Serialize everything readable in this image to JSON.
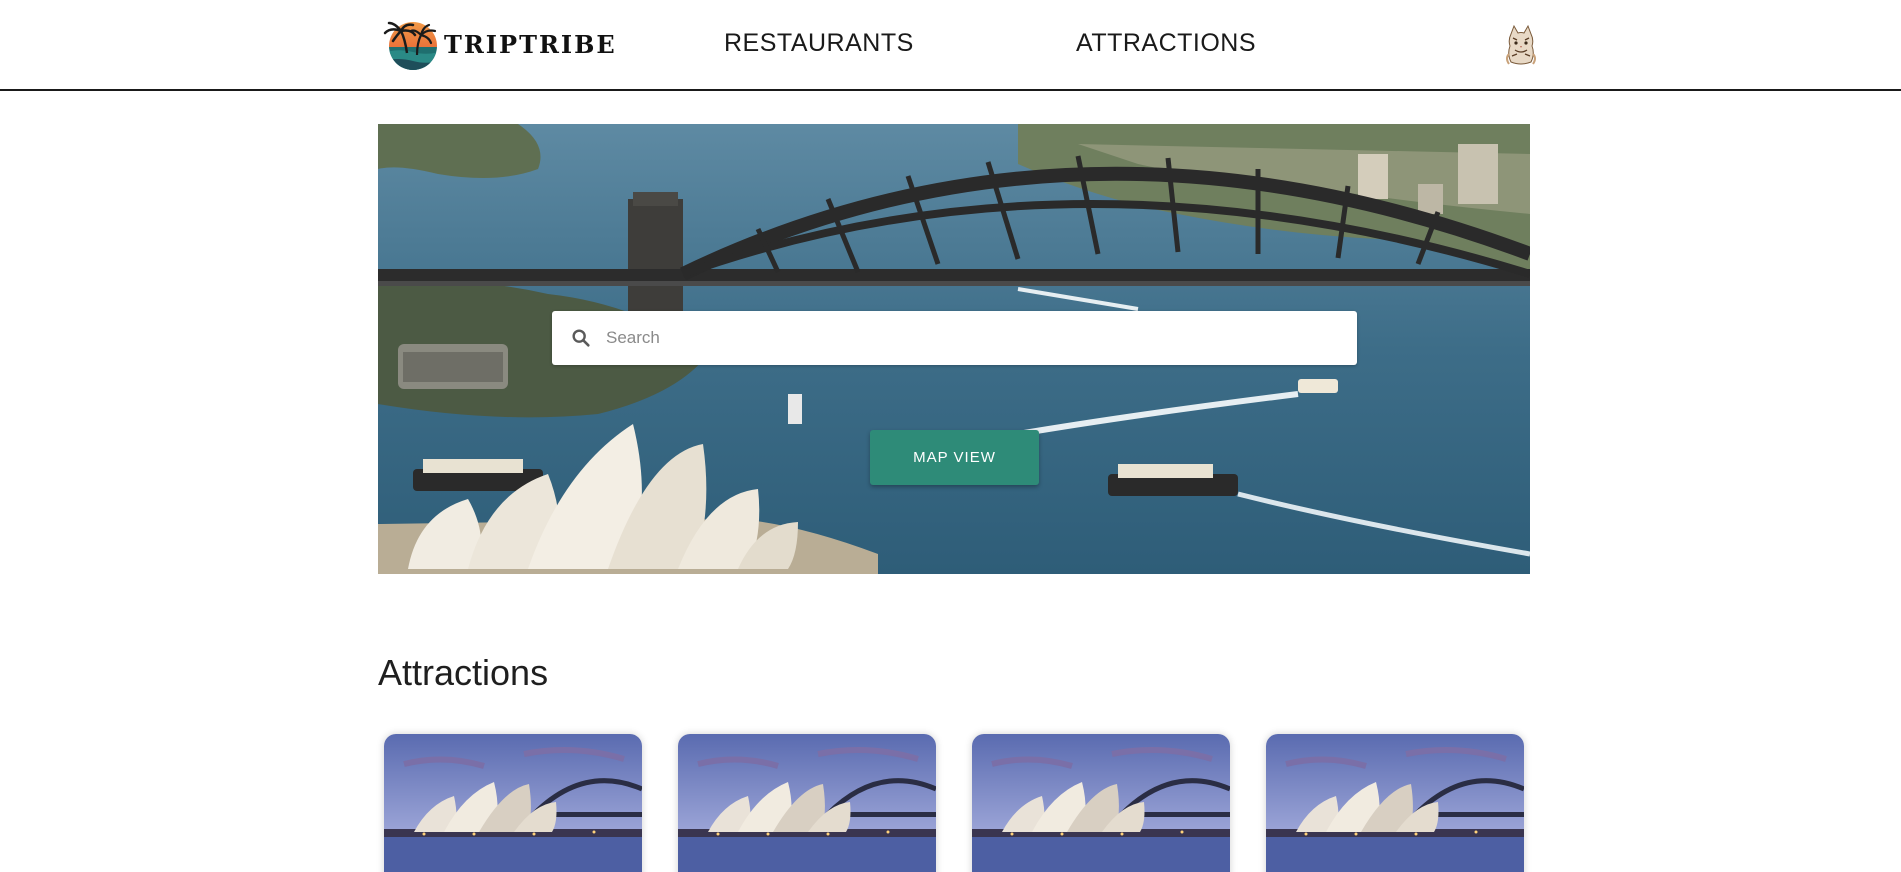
{
  "header": {
    "logo_text": "TRIPTRIBE",
    "nav": {
      "restaurants_label": "RESTAURANTS",
      "attractions_label": "ATTRACTIONS"
    },
    "avatar_icon": "cat-avatar-icon"
  },
  "hero": {
    "image": "sydney-harbour-bridge-opera-house-aerial",
    "search": {
      "placeholder": "Search",
      "value": "",
      "icon": "search-icon"
    },
    "map_view_label": "MAP VIEW"
  },
  "attractions": {
    "title": "Attractions",
    "cards": [
      {
        "image": "sydney-opera-house-dusk"
      },
      {
        "image": "sydney-opera-house-dusk"
      },
      {
        "image": "sydney-opera-house-dusk"
      },
      {
        "image": "sydney-opera-house-dusk"
      }
    ]
  },
  "colors": {
    "accent": "#2e8b78",
    "header_border": "#1a1a1a",
    "text": "#1f1f1f"
  }
}
